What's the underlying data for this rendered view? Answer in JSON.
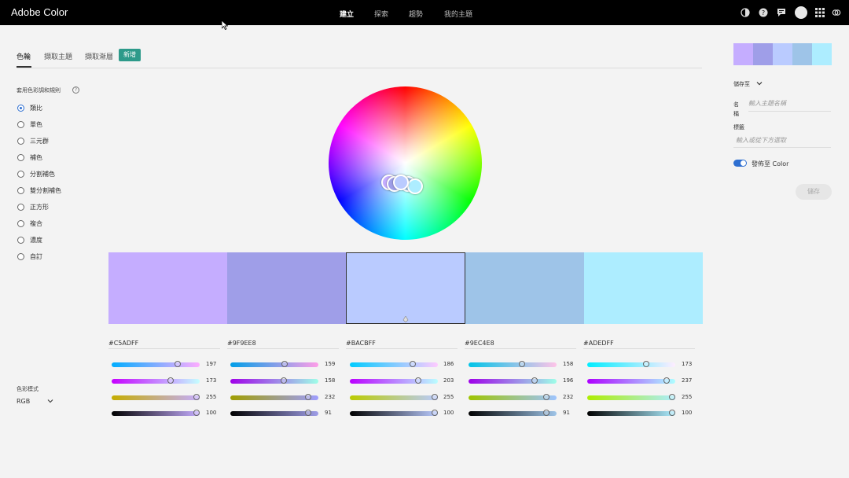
{
  "app": {
    "title": "Adobe Color"
  },
  "nav": {
    "items": [
      "建立",
      "探索",
      "趨勢",
      "我的主題"
    ],
    "active": "建立"
  },
  "topbar_icons": [
    "theme-contrast-icon",
    "help-icon",
    "feedback-icon",
    "avatar",
    "apps-grid-icon",
    "creative-cloud-icon"
  ],
  "tabs": {
    "items": [
      "色輪",
      "擷取主題",
      "擷取漸層"
    ],
    "active": "色輪",
    "new_badge": "新增"
  },
  "harmony": {
    "title": "套用色彩調和規則",
    "items": [
      "類比",
      "單色",
      "三元群",
      "補色",
      "分割補色",
      "雙分割補色",
      "正方形",
      "複合",
      "濃度",
      "自訂"
    ],
    "selected": "類比"
  },
  "color_mode": {
    "label": "色彩模式",
    "value": "RGB"
  },
  "swatches": [
    {
      "hex": "#C5ADFF",
      "color": "#c5adff",
      "rgb": [
        197,
        173,
        255
      ],
      "brightness": 100
    },
    {
      "hex": "#9F9EE8",
      "color": "#9f9ee8",
      "rgb": [
        159,
        158,
        232
      ],
      "brightness": 91
    },
    {
      "hex": "#BACBFF",
      "color": "#bacbff",
      "rgb": [
        186,
        203,
        255
      ],
      "brightness": 100
    },
    {
      "hex": "#9EC4E8",
      "color": "#9ec4e8",
      "rgb": [
        158,
        196,
        232
      ],
      "brightness": 91
    },
    {
      "hex": "#ADEDFF",
      "color": "#adedff",
      "rgb": [
        173,
        237,
        255
      ],
      "brightness": 100
    }
  ],
  "selected_swatch": 2,
  "theme": {
    "save_to": "儲存至",
    "name_label": "名稱",
    "name_placeholder": "輸入主題名稱",
    "tags_label": "標籤",
    "tags_placeholder": "輸入或從下方選取",
    "publish_label": "發佈至 Color",
    "publish_on": true,
    "save_button": "儲存"
  }
}
